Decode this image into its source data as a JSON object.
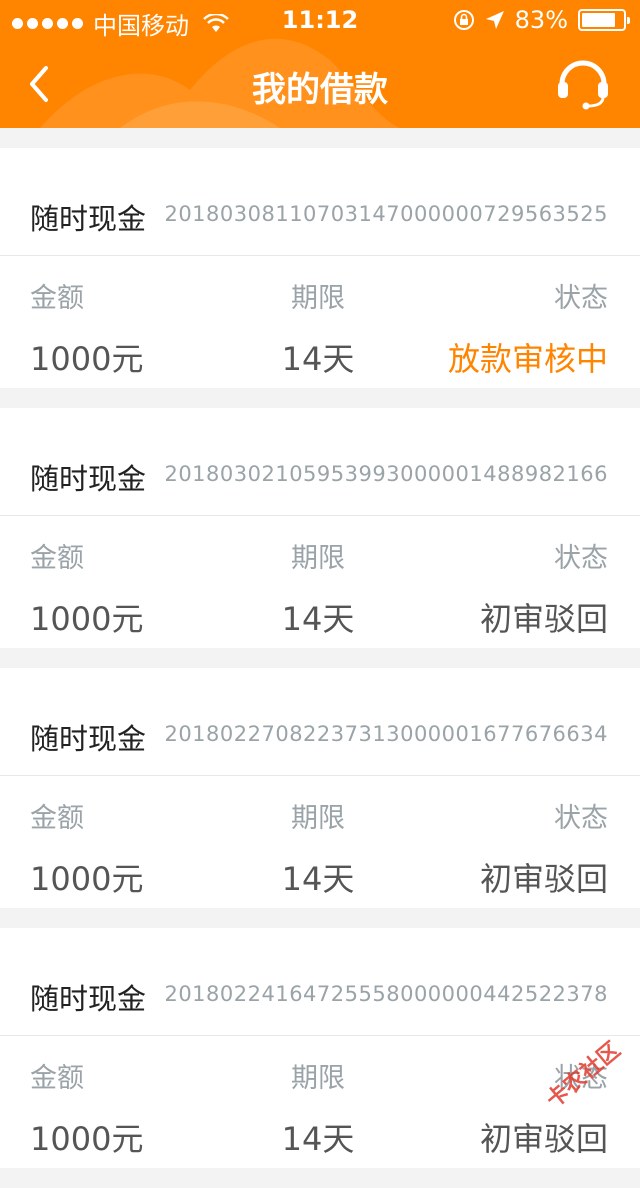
{
  "status_bar": {
    "carrier": "中国移动",
    "time": "11:12",
    "battery_percent": "83%",
    "battery_level": 0.83
  },
  "nav": {
    "title": "我的借款"
  },
  "colors": {
    "accent": "#ff8400",
    "muted_text": "#9aa3a8",
    "value_text": "#555555"
  },
  "loans": [
    {
      "product": "随时现金",
      "order_no": "201803081107031470000007295635​25",
      "amount_label": "金额",
      "term_label": "期限",
      "status_label": "状态",
      "amount": "1000元",
      "term": "14天",
      "status": "放款审核中",
      "status_highlight": true
    },
    {
      "product": "随时现金",
      "order_no": "20180302105953993000001488982166",
      "amount_label": "金额",
      "term_label": "期限",
      "status_label": "状态",
      "amount": "1000元",
      "term": "14天",
      "status": "初审驳回",
      "status_highlight": false
    },
    {
      "product": "随时现金",
      "order_no": "20180227082237313000001677676634",
      "amount_label": "金额",
      "term_label": "期限",
      "status_label": "状态",
      "amount": "1000元",
      "term": "14天",
      "status": "初审驳回",
      "status_highlight": false
    },
    {
      "product": "随时现金",
      "order_no": "20180224164725558000000442522378",
      "amount_label": "金额",
      "term_label": "期限",
      "status_label": "状态",
      "amount": "1000元",
      "term": "14天",
      "status": "初审驳回",
      "status_highlight": false
    }
  ],
  "watermark": {
    "text": "卡农社区"
  }
}
